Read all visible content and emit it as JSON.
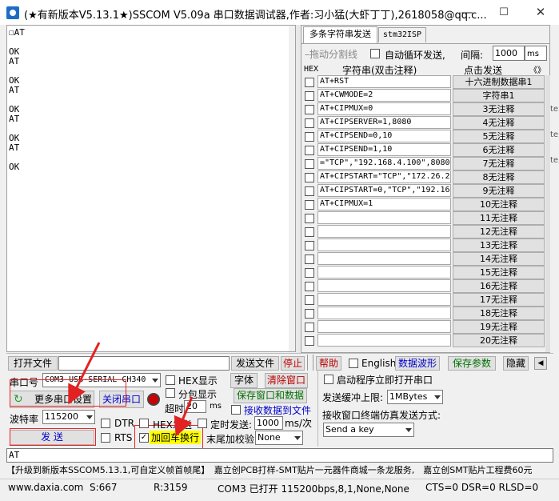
{
  "window": {
    "title": "(★有新版本V5.13.1★)SSCOM V5.09a 串口数据调试器,作者:习小猛(大虾丁丁),2618058@qq.c...",
    "min": "—",
    "max": "☐",
    "close": "✕"
  },
  "receive": {
    "text": "☐AT\n\nOK\nAT\n\nOK\nAT\n\nOK\nAT\n\nOK\nAT\n\nOK"
  },
  "tabs": [
    "多条字符串发送",
    "stm32ISP"
  ],
  "multi": {
    "drag_label": "–拖动分割线",
    "loop_label": "自动循环发送,",
    "interval_label": "间隔:",
    "interval_value": "1000",
    "interval_unit": "ms",
    "hex_header": "HEX",
    "string_header": "字符串(双击注释)",
    "click_send_header": "点击发送",
    "scroll_arrows": "《》",
    "rows": [
      {
        "text": "AT+RST",
        "button": "十六进制数据串1"
      },
      {
        "text": "AT+CWMODE=2",
        "button": "字符串1"
      },
      {
        "text": "AT+CIPMUX=0",
        "button": "3无注释"
      },
      {
        "text": "AT+CIPSERVER=1,8080",
        "button": "4无注释"
      },
      {
        "text": "AT+CIPSEND=0,10",
        "button": "5无注释"
      },
      {
        "text": "AT+CIPSEND=1,10",
        "button": "6无注释"
      },
      {
        "text": "=\"TCP\",\"192.168.4.100\",8080",
        "button": "7无注释"
      },
      {
        "text": "AT+CIPSTART=\"TCP\",\"172.26.2",
        "button": "8无注释"
      },
      {
        "text": "AT+CIPSTART=0,\"TCP\",\"192.168",
        "button": "9无注释"
      },
      {
        "text": "AT+CIPMUX=1",
        "button": "10无注释"
      },
      {
        "text": "",
        "button": "11无注释"
      },
      {
        "text": "",
        "button": "12无注释"
      },
      {
        "text": "",
        "button": "13无注释"
      },
      {
        "text": "",
        "button": "14无注释"
      },
      {
        "text": "",
        "button": "15无注释"
      },
      {
        "text": "",
        "button": "16无注释"
      },
      {
        "text": "",
        "button": "17无注释"
      },
      {
        "text": "",
        "button": "18无注释"
      },
      {
        "text": "",
        "button": "19无注释"
      },
      {
        "text": "",
        "button": "20无注释"
      }
    ]
  },
  "toolbar": {
    "open_file": "打开文件",
    "send_file": "发送文件",
    "stop": "停止",
    "help": "帮助",
    "english": "English",
    "data_wave": "数据波形",
    "save_params": "保存参数",
    "hide": "隐藏"
  },
  "port": {
    "port_label": "串口号",
    "port_value": "COM3 USB-SERIAL CH340",
    "more_settings": "更多串口设置",
    "close_port": "关闭串口",
    "baud_label": "波特率",
    "baud_value": "115200",
    "send": "发 送"
  },
  "options": {
    "hex_display": "HEX显示",
    "packet_display": "分包显示",
    "timeout_label": "超时",
    "timeout_value": "20",
    "timeout_unit": "ms",
    "dtr": "DTR",
    "rts": "RTS",
    "hex_send": "HEX发送",
    "timed_send": "定时发送:",
    "timed_value": "1000",
    "timed_unit": "ms/次",
    "add_crlf": "加回车换行",
    "checksum_label": "末尾加校验",
    "checksum_value": "None",
    "font": "字体",
    "clear_window": "清除窗口",
    "save_window": "保存窗口和数据",
    "recv_to_file": "接收数据到文件",
    "auto_open": "启动程序立即打开串口",
    "buffer_label": "发送缓冲上限:",
    "buffer_value": "1MBytes",
    "terminal_label": "接收窗口终端仿真发送方式:",
    "terminal_value": "Send a key"
  },
  "send_input": "AT",
  "ad": "【升级到新版本SSCOM5.13.1,可自定义帧首帧尾】　嘉立创PCB打样-SMT贴片一元器件商城一条龙服务,　嘉立创SMT贴片工程费60元",
  "status": {
    "site": "www.daxia.com",
    "sent": "S:667",
    "received": "R:3159",
    "port_state": "COM3 已打开  115200bps,8,1,None,None",
    "lines": "CTS=0 DSR=0 RLSD=0"
  },
  "colors": {
    "highlight_yellow": "#ffff00",
    "annotation_red": "#e22222",
    "link_blue": "#0000cc"
  }
}
